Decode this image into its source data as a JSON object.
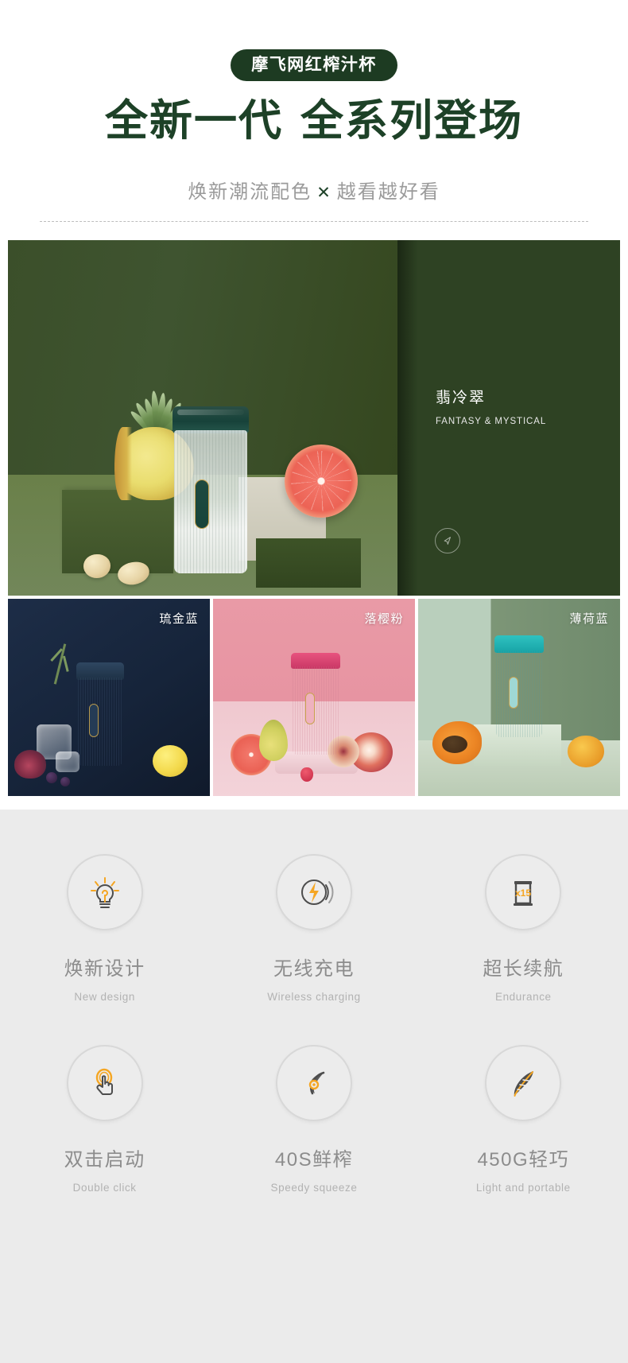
{
  "header": {
    "badge": "摩飞网红榨汁杯",
    "title_part1": "全新一代",
    "title_part2": "全系列登场",
    "subtitle_left": "焕新潮流配色",
    "subtitle_x": "✕",
    "subtitle_right": "越看越好看"
  },
  "hero": {
    "color_name_cn": "翡冷翠",
    "color_name_en": "FANTASY & MYSTICAL",
    "nav_icon": "prev-arrow-icon"
  },
  "thumbnails": [
    {
      "label": "琉金蓝",
      "swatch": "#16243a"
    },
    {
      "label": "落樱粉",
      "swatch": "#e794a2"
    },
    {
      "label": "薄荷蓝",
      "swatch": "#7d9677"
    }
  ],
  "features": [
    {
      "cn": "焕新设计",
      "en": "New design",
      "icon": "lightbulb-icon"
    },
    {
      "cn": "无线充电",
      "en": "Wireless charging",
      "icon": "lightning-bolt-icon"
    },
    {
      "cn": "超长续航",
      "en": "Endurance",
      "icon": "cup-x15-icon",
      "badge": "x15"
    },
    {
      "cn": "双击启动",
      "en": "Double click",
      "icon": "tap-hand-icon"
    },
    {
      "cn": "40S鲜榨",
      "en": "Speedy squeeze",
      "icon": "blade-icon"
    },
    {
      "cn": "450G轻巧",
      "en": "Light and portable",
      "icon": "feather-icon"
    }
  ],
  "colors": {
    "brand_green": "#1d4127",
    "badge_green": "#1d3b22",
    "accent_orange": "#f5a623",
    "feature_bg": "#ebebeb",
    "icon_gray": "#4d4d4d"
  }
}
